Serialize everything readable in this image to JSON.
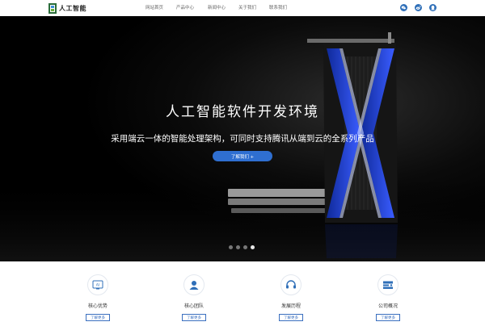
{
  "header": {
    "logo_text": "人工智能",
    "nav": [
      "网站首页",
      "产品中心",
      "新闻中心",
      "关于我们",
      "联系我们"
    ],
    "icons": [
      "weixin-icon",
      "weibo-icon",
      "qq-icon"
    ]
  },
  "hero": {
    "title": "人工智能软件开发环境",
    "subtitle": "采用端云一体的智能处理架构，可同时支持腾讯从端到云的全系列产品",
    "button_label": "了解我们 +",
    "slides_total": 4,
    "active_slide": 4
  },
  "features": [
    {
      "title": "核心优势",
      "button": "了解更多",
      "icon": "ai-chip-icon"
    },
    {
      "title": "核心团队",
      "button": "了解更多",
      "icon": "team-icon"
    },
    {
      "title": "发展历程",
      "button": "了解更多",
      "icon": "headset-icon"
    },
    {
      "title": "公司概况",
      "button": "了解更多",
      "icon": "company-icon"
    }
  ],
  "colors": {
    "accent": "#2f6fd1",
    "hero_bg": "#000000",
    "gpu_blue": "#1f3fbf"
  }
}
